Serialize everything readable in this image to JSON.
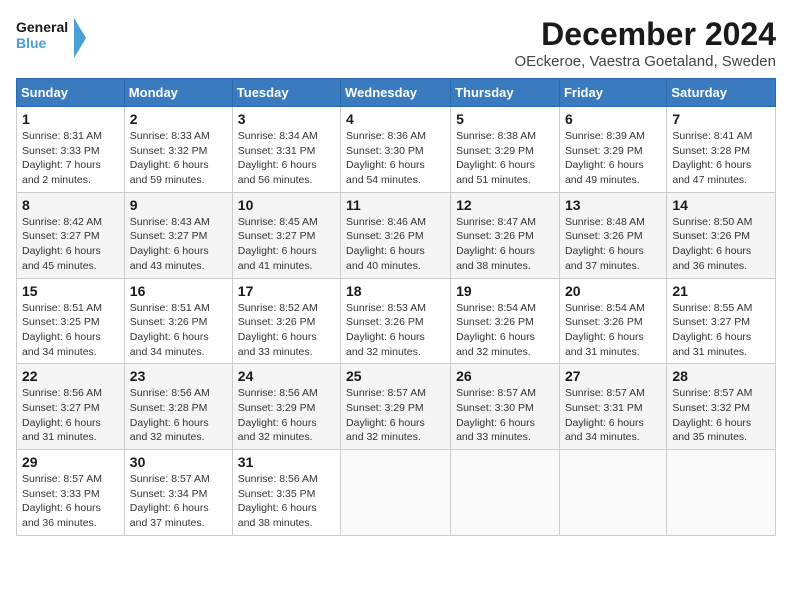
{
  "header": {
    "logo_line1": "General",
    "logo_line2": "Blue",
    "title": "December 2024",
    "subtitle": "OEckeroe, Vaestra Goetaland, Sweden"
  },
  "days_of_week": [
    "Sunday",
    "Monday",
    "Tuesday",
    "Wednesday",
    "Thursday",
    "Friday",
    "Saturday"
  ],
  "weeks": [
    [
      {
        "day": "1",
        "sunrise": "Sunrise: 8:31 AM",
        "sunset": "Sunset: 3:33 PM",
        "daylight": "Daylight: 7 hours and 2 minutes."
      },
      {
        "day": "2",
        "sunrise": "Sunrise: 8:33 AM",
        "sunset": "Sunset: 3:32 PM",
        "daylight": "Daylight: 6 hours and 59 minutes."
      },
      {
        "day": "3",
        "sunrise": "Sunrise: 8:34 AM",
        "sunset": "Sunset: 3:31 PM",
        "daylight": "Daylight: 6 hours and 56 minutes."
      },
      {
        "day": "4",
        "sunrise": "Sunrise: 8:36 AM",
        "sunset": "Sunset: 3:30 PM",
        "daylight": "Daylight: 6 hours and 54 minutes."
      },
      {
        "day": "5",
        "sunrise": "Sunrise: 8:38 AM",
        "sunset": "Sunset: 3:29 PM",
        "daylight": "Daylight: 6 hours and 51 minutes."
      },
      {
        "day": "6",
        "sunrise": "Sunrise: 8:39 AM",
        "sunset": "Sunset: 3:29 PM",
        "daylight": "Daylight: 6 hours and 49 minutes."
      },
      {
        "day": "7",
        "sunrise": "Sunrise: 8:41 AM",
        "sunset": "Sunset: 3:28 PM",
        "daylight": "Daylight: 6 hours and 47 minutes."
      }
    ],
    [
      {
        "day": "8",
        "sunrise": "Sunrise: 8:42 AM",
        "sunset": "Sunset: 3:27 PM",
        "daylight": "Daylight: 6 hours and 45 minutes."
      },
      {
        "day": "9",
        "sunrise": "Sunrise: 8:43 AM",
        "sunset": "Sunset: 3:27 PM",
        "daylight": "Daylight: 6 hours and 43 minutes."
      },
      {
        "day": "10",
        "sunrise": "Sunrise: 8:45 AM",
        "sunset": "Sunset: 3:27 PM",
        "daylight": "Daylight: 6 hours and 41 minutes."
      },
      {
        "day": "11",
        "sunrise": "Sunrise: 8:46 AM",
        "sunset": "Sunset: 3:26 PM",
        "daylight": "Daylight: 6 hours and 40 minutes."
      },
      {
        "day": "12",
        "sunrise": "Sunrise: 8:47 AM",
        "sunset": "Sunset: 3:26 PM",
        "daylight": "Daylight: 6 hours and 38 minutes."
      },
      {
        "day": "13",
        "sunrise": "Sunrise: 8:48 AM",
        "sunset": "Sunset: 3:26 PM",
        "daylight": "Daylight: 6 hours and 37 minutes."
      },
      {
        "day": "14",
        "sunrise": "Sunrise: 8:50 AM",
        "sunset": "Sunset: 3:26 PM",
        "daylight": "Daylight: 6 hours and 36 minutes."
      }
    ],
    [
      {
        "day": "15",
        "sunrise": "Sunrise: 8:51 AM",
        "sunset": "Sunset: 3:25 PM",
        "daylight": "Daylight: 6 hours and 34 minutes."
      },
      {
        "day": "16",
        "sunrise": "Sunrise: 8:51 AM",
        "sunset": "Sunset: 3:26 PM",
        "daylight": "Daylight: 6 hours and 34 minutes."
      },
      {
        "day": "17",
        "sunrise": "Sunrise: 8:52 AM",
        "sunset": "Sunset: 3:26 PM",
        "daylight": "Daylight: 6 hours and 33 minutes."
      },
      {
        "day": "18",
        "sunrise": "Sunrise: 8:53 AM",
        "sunset": "Sunset: 3:26 PM",
        "daylight": "Daylight: 6 hours and 32 minutes."
      },
      {
        "day": "19",
        "sunrise": "Sunrise: 8:54 AM",
        "sunset": "Sunset: 3:26 PM",
        "daylight": "Daylight: 6 hours and 32 minutes."
      },
      {
        "day": "20",
        "sunrise": "Sunrise: 8:54 AM",
        "sunset": "Sunset: 3:26 PM",
        "daylight": "Daylight: 6 hours and 31 minutes."
      },
      {
        "day": "21",
        "sunrise": "Sunrise: 8:55 AM",
        "sunset": "Sunset: 3:27 PM",
        "daylight": "Daylight: 6 hours and 31 minutes."
      }
    ],
    [
      {
        "day": "22",
        "sunrise": "Sunrise: 8:56 AM",
        "sunset": "Sunset: 3:27 PM",
        "daylight": "Daylight: 6 hours and 31 minutes."
      },
      {
        "day": "23",
        "sunrise": "Sunrise: 8:56 AM",
        "sunset": "Sunset: 3:28 PM",
        "daylight": "Daylight: 6 hours and 32 minutes."
      },
      {
        "day": "24",
        "sunrise": "Sunrise: 8:56 AM",
        "sunset": "Sunset: 3:29 PM",
        "daylight": "Daylight: 6 hours and 32 minutes."
      },
      {
        "day": "25",
        "sunrise": "Sunrise: 8:57 AM",
        "sunset": "Sunset: 3:29 PM",
        "daylight": "Daylight: 6 hours and 32 minutes."
      },
      {
        "day": "26",
        "sunrise": "Sunrise: 8:57 AM",
        "sunset": "Sunset: 3:30 PM",
        "daylight": "Daylight: 6 hours and 33 minutes."
      },
      {
        "day": "27",
        "sunrise": "Sunrise: 8:57 AM",
        "sunset": "Sunset: 3:31 PM",
        "daylight": "Daylight: 6 hours and 34 minutes."
      },
      {
        "day": "28",
        "sunrise": "Sunrise: 8:57 AM",
        "sunset": "Sunset: 3:32 PM",
        "daylight": "Daylight: 6 hours and 35 minutes."
      }
    ],
    [
      {
        "day": "29",
        "sunrise": "Sunrise: 8:57 AM",
        "sunset": "Sunset: 3:33 PM",
        "daylight": "Daylight: 6 hours and 36 minutes."
      },
      {
        "day": "30",
        "sunrise": "Sunrise: 8:57 AM",
        "sunset": "Sunset: 3:34 PM",
        "daylight": "Daylight: 6 hours and 37 minutes."
      },
      {
        "day": "31",
        "sunrise": "Sunrise: 8:56 AM",
        "sunset": "Sunset: 3:35 PM",
        "daylight": "Daylight: 6 hours and 38 minutes."
      },
      null,
      null,
      null,
      null
    ]
  ]
}
